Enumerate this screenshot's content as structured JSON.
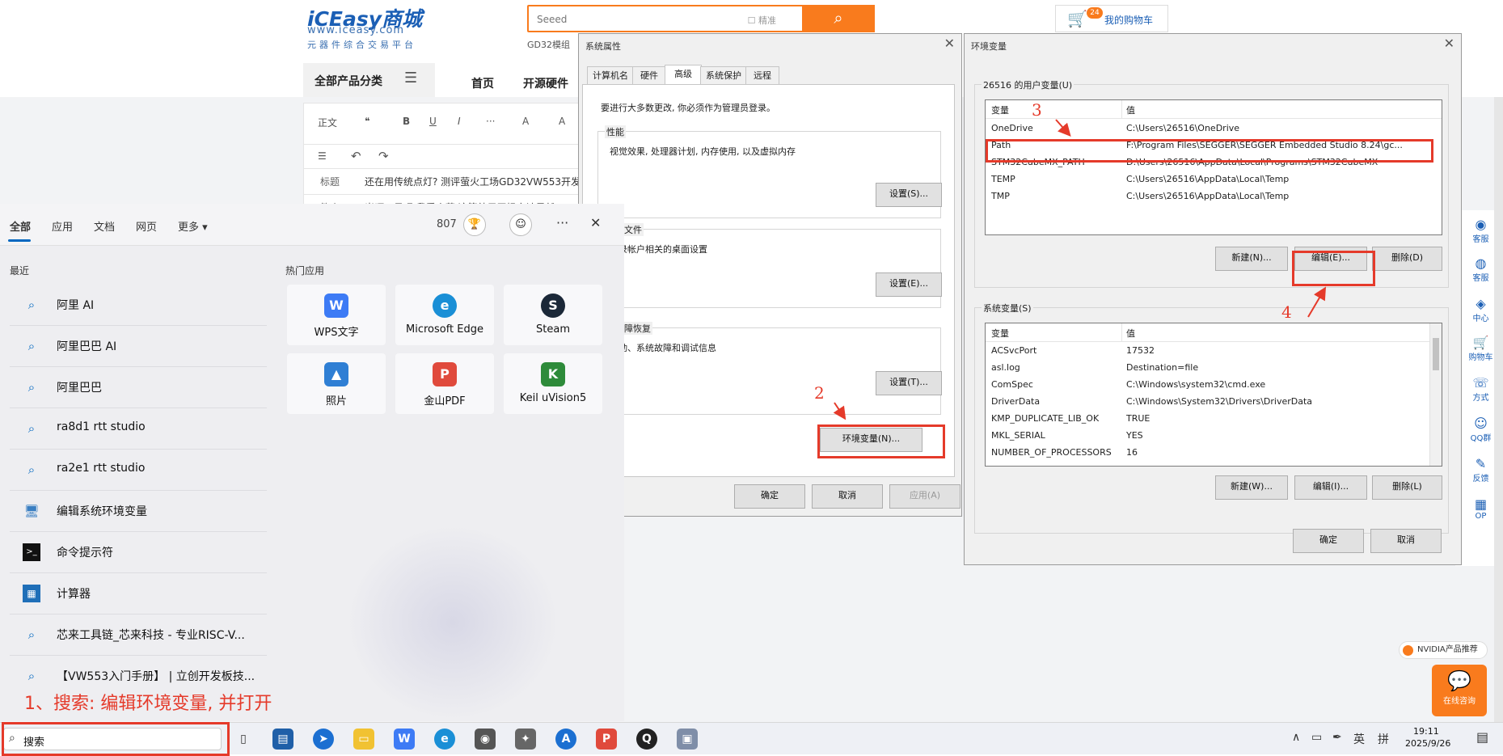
{
  "site": {
    "logo_text": "iCEasy商城",
    "logo_url": "www.iceasy.com",
    "logo_sub": "元器件综合交易平台",
    "search_placeholder": "Seeed",
    "search_exact": "精准",
    "search_sub_link": "GD32模组",
    "cart_count": "24",
    "cart_label": "我的购物车",
    "category_label": "全部产品分类",
    "nav": [
      "首页",
      "开源硬件"
    ],
    "editor_toolbar": [
      "正文",
      "❝",
      "B",
      "U",
      "I",
      "···",
      "A",
      "A"
    ],
    "editor_title_label": "标题",
    "editor_title_value": "还在用传统点灯? 测评萤火工场GD32VW553开发",
    "editor_summary_label": "简介",
    "editor_summary_value": "米呵一贝呢 我爱小菜 这等幼子玉妈安诗是然",
    "sidebar": [
      "客服",
      "客服",
      "中心",
      "购物车",
      "方式",
      "QQ群",
      "反馈",
      "OP"
    ],
    "nvidia_badge": "NVIDIA产品推荐",
    "consult_label": "在线咨询"
  },
  "sys_props": {
    "title": "系统属性",
    "tabs": [
      "计算机名",
      "硬件",
      "高级",
      "系统保护",
      "远程"
    ],
    "active_tab": "高级",
    "admin_note": "要进行大多数更改, 你必须作为管理员登录。",
    "performance": {
      "label": "性能",
      "desc": "视觉效果, 处理器计划, 内存使用, 以及虚拟内存",
      "button": "设置(S)..."
    },
    "profile": {
      "label": "配置文件",
      "desc": "登录帐户相关的桌面设置",
      "button": "设置(E)..."
    },
    "startup": {
      "label": "和故障恢复",
      "desc": "启动、系统故障和调试信息",
      "button": "设置(T)..."
    },
    "env_button": "环境变量(N)...",
    "ok": "确定",
    "cancel": "取消",
    "apply": "应用(A)"
  },
  "env": {
    "title": "环境变量",
    "user_group": "26516 的用户变量(U)",
    "col_var": "变量",
    "col_val": "值",
    "user_vars": [
      {
        "name": "OneDrive",
        "value": "C:\\Users\\26516\\OneDrive"
      },
      {
        "name": "Path",
        "value": "F:\\Program Files\\SEGGER\\SEGGER Embedded Studio 8.24\\gc..."
      },
      {
        "name": "STM32CubeMX_PATH",
        "value": "D:\\Users\\26516\\AppData\\Local\\Programs\\STM32CubeMX"
      },
      {
        "name": "TEMP",
        "value": "C:\\Users\\26516\\AppData\\Local\\Temp"
      },
      {
        "name": "TMP",
        "value": "C:\\Users\\26516\\AppData\\Local\\Temp"
      }
    ],
    "user_buttons": [
      "新建(N)...",
      "编辑(E)...",
      "删除(D)"
    ],
    "sys_group": "系统变量(S)",
    "sys_vars": [
      {
        "name": "ACSvcPort",
        "value": "17532"
      },
      {
        "name": "asl.log",
        "value": "Destination=file"
      },
      {
        "name": "ComSpec",
        "value": "C:\\Windows\\system32\\cmd.exe"
      },
      {
        "name": "DriverData",
        "value": "C:\\Windows\\System32\\Drivers\\DriverData"
      },
      {
        "name": "KMP_DUPLICATE_LIB_OK",
        "value": "TRUE"
      },
      {
        "name": "MKL_SERIAL",
        "value": "YES"
      },
      {
        "name": "NUMBER_OF_PROCESSORS",
        "value": "16"
      }
    ],
    "sys_buttons": [
      "新建(W)...",
      "编辑(I)...",
      "删除(L)"
    ],
    "ok": "确定",
    "cancel": "取消"
  },
  "start_menu": {
    "tabs": [
      "全部",
      "应用",
      "文档",
      "网页",
      "更多 ▾"
    ],
    "points": "807",
    "recent_title": "最近",
    "recent": [
      {
        "label": "阿里 AI",
        "icon": "search-icon"
      },
      {
        "label": "阿里巴巴 AI",
        "icon": "search-icon"
      },
      {
        "label": "阿里巴巴",
        "icon": "search-icon"
      },
      {
        "label": "ra8d1 rtt studio",
        "icon": "search-icon"
      },
      {
        "label": "ra2e1 rtt studio",
        "icon": "search-icon"
      },
      {
        "label": "编辑系统环境变量",
        "icon": "control-panel-icon"
      },
      {
        "label": "命令提示符",
        "icon": "terminal-icon"
      },
      {
        "label": "计算器",
        "icon": "calculator-icon"
      },
      {
        "label": "芯来工具链_芯来科技 - 专业RISC-V...",
        "icon": "search-icon"
      },
      {
        "label": "【VW553入门手册】 | 立创开发板技...",
        "icon": "search-icon"
      }
    ],
    "hot_title": "热门应用",
    "hot_apps": [
      {
        "label": "WPS文字",
        "color": "#3d7bf5",
        "glyph": "W"
      },
      {
        "label": "Microsoft Edge",
        "color": "#1a8fd6",
        "glyph": "e"
      },
      {
        "label": "Steam",
        "color": "#1b2838",
        "glyph": "S"
      },
      {
        "label": "照片",
        "color": "#2f7fd4",
        "glyph": "▲"
      },
      {
        "label": "金山PDF",
        "color": "#e04a3c",
        "glyph": "P"
      },
      {
        "label": "Keil uVision5",
        "color": "#2e8b3a",
        "glyph": "K"
      }
    ]
  },
  "taskbar": {
    "search_text": "搜索",
    "time": "19:11",
    "date": "2025/9/26",
    "ime": "英",
    "ime2": "拼"
  },
  "annotations": {
    "step1": "1、搜索: 编辑环境变量, 并打开",
    "step2": "2",
    "step3": "3",
    "step4": "4"
  },
  "colors": {
    "accent": "#f97b1d",
    "annotation": "#e53a2a",
    "brand": "#1b5fb5"
  }
}
